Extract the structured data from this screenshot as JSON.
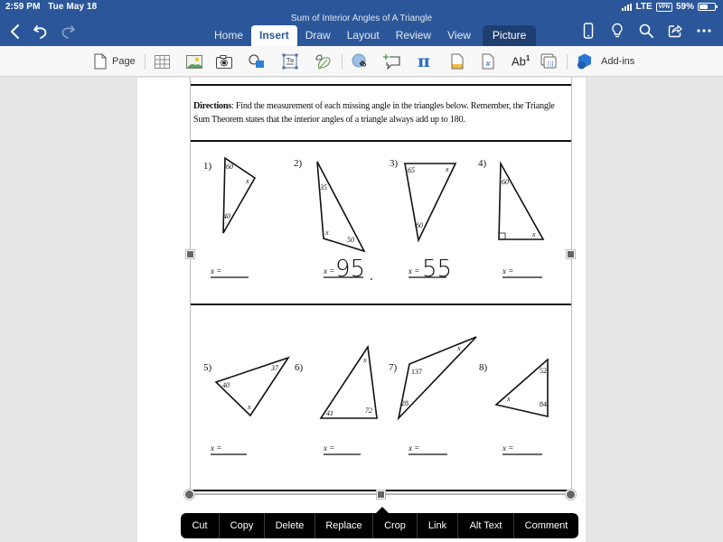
{
  "status_bar": {
    "time": "2:59 PM",
    "date": "Tue May 18",
    "network": "LTE",
    "vpn": "VPN",
    "battery_text": "59%",
    "battery_level": 0.59
  },
  "header": {
    "document_title": "Sum of Interior Angles of A Triangle",
    "tabs": [
      {
        "label": "Home"
      },
      {
        "label": "Insert"
      },
      {
        "label": "Draw"
      },
      {
        "label": "Layout"
      },
      {
        "label": "Review"
      },
      {
        "label": "View"
      },
      {
        "label": "Picture"
      }
    ],
    "active_tab": "Insert",
    "context_tab": "Picture"
  },
  "ribbon": {
    "page_label": "Page",
    "superscript_label": "Ab",
    "superscript_mark": "1",
    "addins_label": "Add-ins"
  },
  "worksheet": {
    "directions_label": "Directions",
    "directions_text": ":  Find the measurement of each missing angle in the triangles below.  Remember, the Triangle Sum Theorem states that the interior angles of a triangle always add up to 180.",
    "answer_label": "x =",
    "problems": [
      {
        "number": "1)",
        "angles": [
          "60",
          "40",
          "x"
        ],
        "answer": ""
      },
      {
        "number": "2)",
        "angles": [
          "35",
          "x",
          "50"
        ],
        "answer": "95"
      },
      {
        "number": "3)",
        "angles": [
          "65",
          "x",
          "60"
        ],
        "answer": "55"
      },
      {
        "number": "4)",
        "angles": [
          "60",
          "90",
          "x"
        ],
        "answer": ""
      },
      {
        "number": "5)",
        "angles": [
          "40",
          "37",
          "x"
        ],
        "answer": ""
      },
      {
        "number": "6)",
        "angles": [
          "x",
          "41",
          "72"
        ],
        "answer": ""
      },
      {
        "number": "7)",
        "angles": [
          "137",
          "28",
          "x"
        ],
        "answer": ""
      },
      {
        "number": "8)",
        "angles": [
          "52",
          "84",
          "x"
        ],
        "answer": ""
      }
    ]
  },
  "context_menu": {
    "items": [
      {
        "label": "Cut"
      },
      {
        "label": "Copy"
      },
      {
        "label": "Delete"
      },
      {
        "label": "Replace"
      },
      {
        "label": "Crop"
      },
      {
        "label": "Link"
      },
      {
        "label": "Alt Text"
      },
      {
        "label": "Comment"
      }
    ]
  },
  "colors": {
    "header_bg": "#2b579a",
    "context_tab_bg": "#1f3e6f",
    "ribbon_bg": "#f8f8f8",
    "canvas_bg": "#e6e6e6"
  }
}
